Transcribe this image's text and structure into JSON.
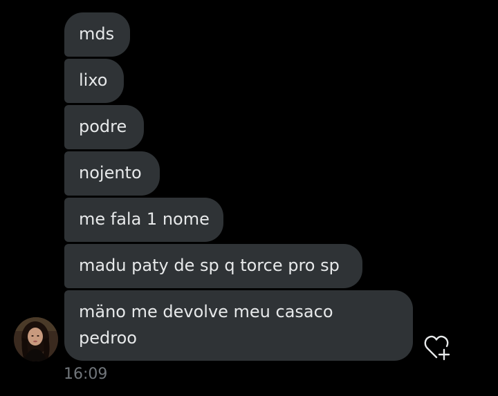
{
  "conversation": {
    "messages": [
      {
        "text": "mds"
      },
      {
        "text": "lixo"
      },
      {
        "text": "podre"
      },
      {
        "text": "nojento"
      },
      {
        "text": "me fala 1 nome"
      },
      {
        "text": "madu paty de sp q torce pro sp"
      },
      {
        "text_line1": "mäno me devolve meu casaco",
        "text_line2": "pedroo"
      }
    ],
    "timestamp": "16:09"
  },
  "icons": {
    "avatar": "user-avatar",
    "reaction": "heart-add-icon"
  },
  "colors": {
    "background": "#000000",
    "bubble": "#2f3336",
    "text": "#e7e9ea",
    "muted": "#71767b"
  }
}
